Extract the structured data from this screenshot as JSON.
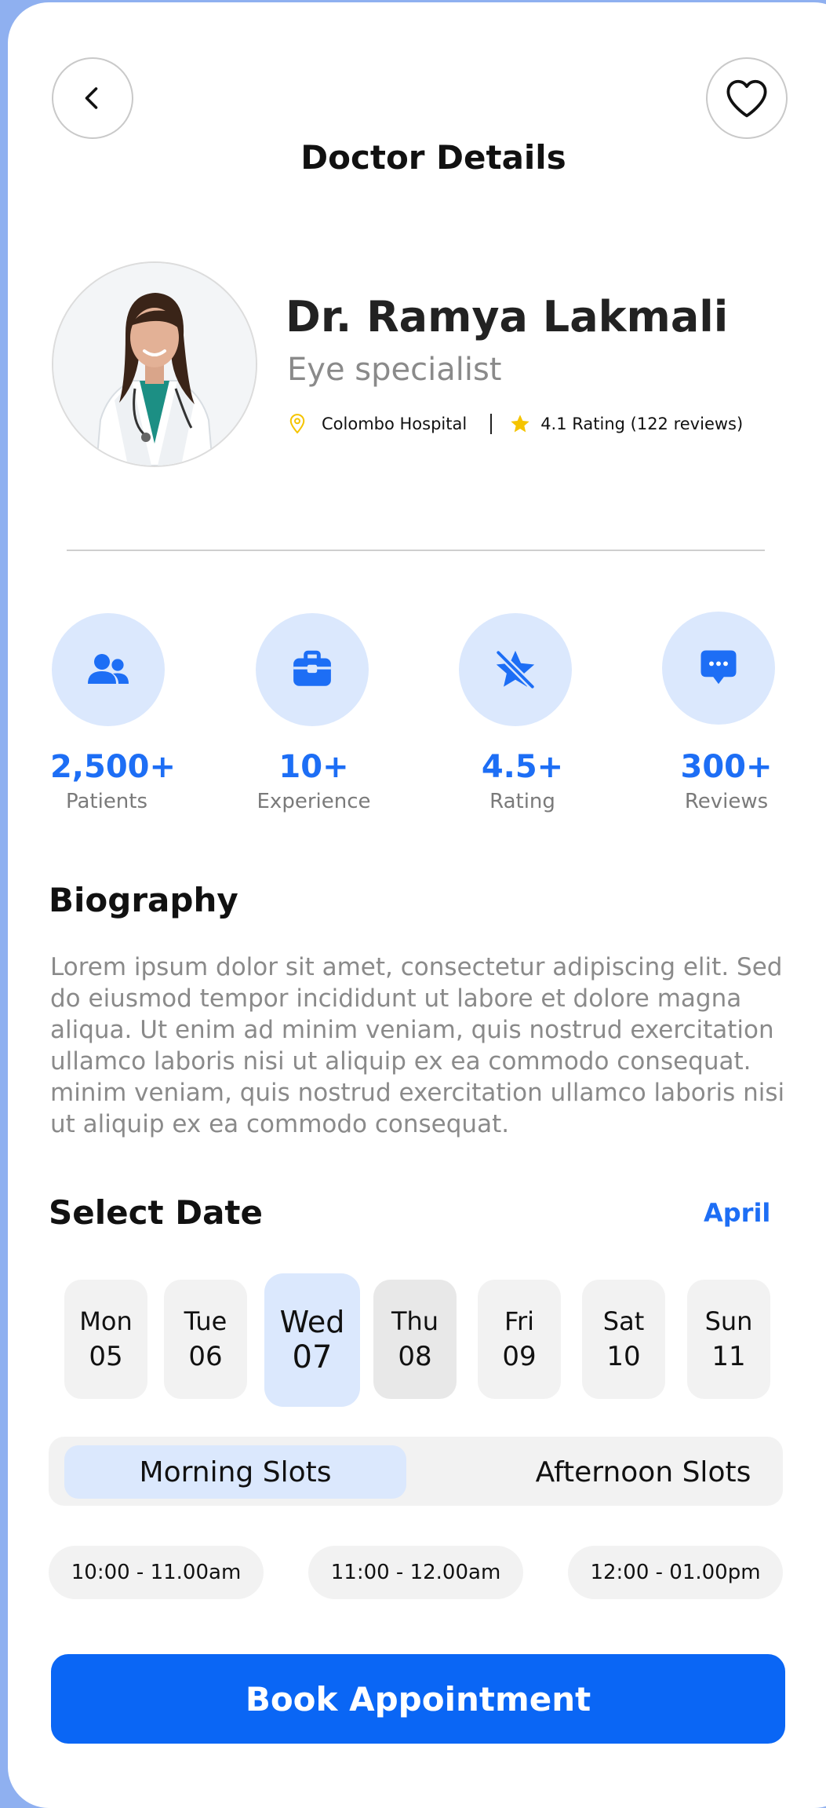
{
  "header": {
    "title": "Doctor Details",
    "back_icon": "chevron-left-icon",
    "favorite_icon": "heart-outline-icon"
  },
  "doctor": {
    "name": "Dr. Ramya Lakmali",
    "specialty": "Eye specialist",
    "hospital": "Colombo Hospital",
    "rating_text": "4.1 Rating (122 reviews)"
  },
  "stats": [
    {
      "value": "2,500+",
      "label": "Patients",
      "icon": "users-icon"
    },
    {
      "value": "10+",
      "label": "Experience",
      "icon": "briefcase-icon"
    },
    {
      "value": "4.5+",
      "label": "Rating",
      "icon": "star-slash-icon"
    },
    {
      "value": "300+",
      "label": "Reviews",
      "icon": "chat-bubble-icon"
    }
  ],
  "biography": {
    "title": "Biography",
    "text": "Lorem ipsum dolor sit amet, consectetur adipiscing elit. Sed do eiusmod tempor incididunt ut labore et dolore magna aliqua. Ut enim ad minim veniam, quis nostrud exercitation ullamco laboris nisi ut aliquip ex ea commodo consequat. minim veniam, quis nostrud exercitation ullamco laboris nisi ut aliquip ex ea commodo consequat."
  },
  "date_picker": {
    "title": "Select Date",
    "month": "April",
    "days": [
      {
        "name": "Mon",
        "num": "05"
      },
      {
        "name": "Tue",
        "num": "06"
      },
      {
        "name": "Wed",
        "num": "07"
      },
      {
        "name": "Thu",
        "num": "08"
      },
      {
        "name": "Fri",
        "num": "09"
      },
      {
        "name": "Sat",
        "num": "10"
      },
      {
        "name": "Sun",
        "num": "11"
      }
    ],
    "selected_day": "Wed"
  },
  "slots": {
    "tabs": [
      "Morning Slots",
      "Afternoon Slots"
    ],
    "active_tab": "Morning Slots",
    "times": [
      "10:00 - 11.00am",
      "11:00 - 12.00am",
      "12:00 - 01.00pm"
    ]
  },
  "cta": {
    "label": "Book Appointment"
  },
  "colors": {
    "accent": "#0a66f5",
    "accent_light": "#dbe8fd",
    "star": "#f5c400",
    "frame": "#8fb0f0"
  }
}
